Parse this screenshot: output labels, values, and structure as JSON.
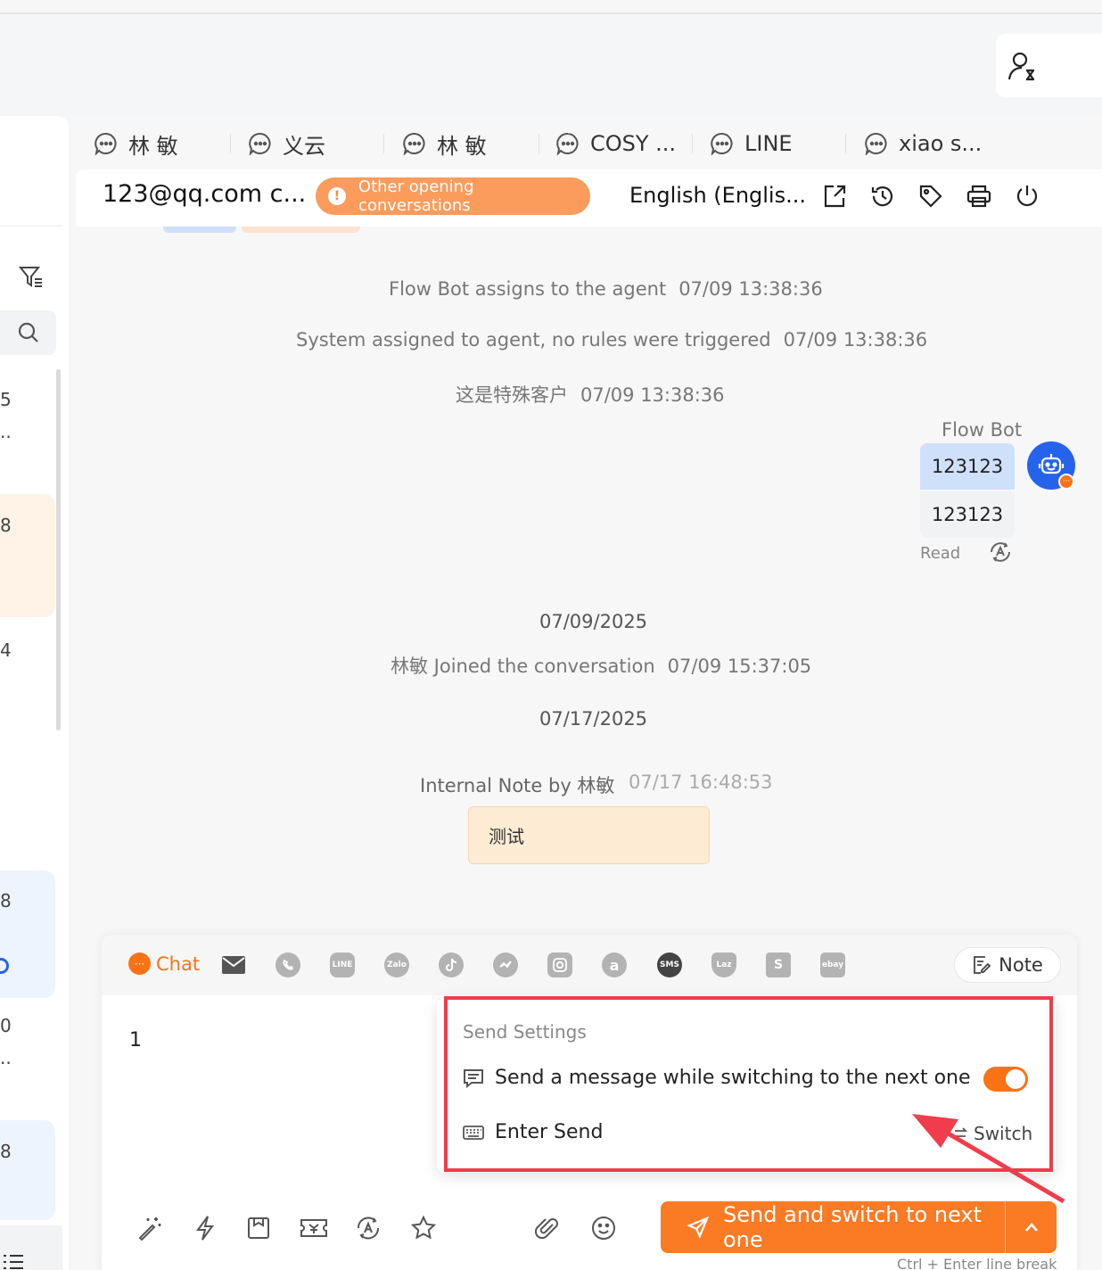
{
  "tabs": [
    {
      "label": "林 敏",
      "icon": "chat-bubble-icon"
    },
    {
      "label": "义云",
      "icon": "chat-bubble-icon"
    },
    {
      "label": "林 敏",
      "icon": "chat-bubble-icon"
    },
    {
      "label": "COSY ...",
      "icon": "chat-bubble-icon"
    },
    {
      "label": "LINE",
      "icon": "chat-bubble-icon"
    },
    {
      "label": "xiao s...",
      "icon": "chat-bubble-icon"
    }
  ],
  "left_list": {
    "fragments": [
      "5",
      "..",
      "8",
      "4",
      "8",
      "0",
      "..",
      "8"
    ]
  },
  "header": {
    "contact": "123@qq.com c...",
    "alert": "Other opening conversations",
    "language": "English (Englis..."
  },
  "messages": {
    "system": [
      {
        "text": "Flow Bot assigns to the agent",
        "time": "07/09 13:38:36"
      },
      {
        "text": "System assigned to agent, no rules were triggered",
        "time": "07/09 13:38:36"
      },
      {
        "text": "这是特殊客户",
        "time": "07/09 13:38:36"
      }
    ],
    "bot_name": "Flow Bot",
    "bot_bubbles": [
      "123123",
      "123123"
    ],
    "read_label": "Read",
    "date1": "07/09/2025",
    "joined": {
      "text": "林敏 Joined the conversation",
      "time": "07/09 15:37:05"
    },
    "date2": "07/17/2025",
    "note": {
      "by": "Internal Note by 林敏",
      "time": "07/17 16:48:53",
      "text": "测试"
    }
  },
  "composer": {
    "chat_label": "Chat",
    "note_label": "Note",
    "input_value": "1",
    "channels": [
      "email-icon",
      "whatsapp-icon",
      "line-icon",
      "zalo-icon",
      "tiktok-icon",
      "messenger-icon",
      "instagram-icon",
      "amazon-icon",
      "sms-icon",
      "lazada-icon",
      "shopify-icon",
      "ebay-icon"
    ],
    "channel_texts": {
      "line": "LINE",
      "zalo": "Zalo",
      "sms": "SMS",
      "lazada": "Laz",
      "ebay": "ebay"
    },
    "send_label": "Send and switch to next one",
    "hint": "Ctrl + Enter line break"
  },
  "send_settings": {
    "title": "Send Settings",
    "option1": "Send a message while switching to the next one",
    "option1_enabled": true,
    "option2": "Enter Send",
    "switch_label": "Switch"
  },
  "colors": {
    "accent": "#f97316",
    "bot_blue": "#2563eb",
    "bubble": "#cfe0fb",
    "note_bg": "#fdebd3",
    "annotation_red": "#ef3d4b"
  }
}
